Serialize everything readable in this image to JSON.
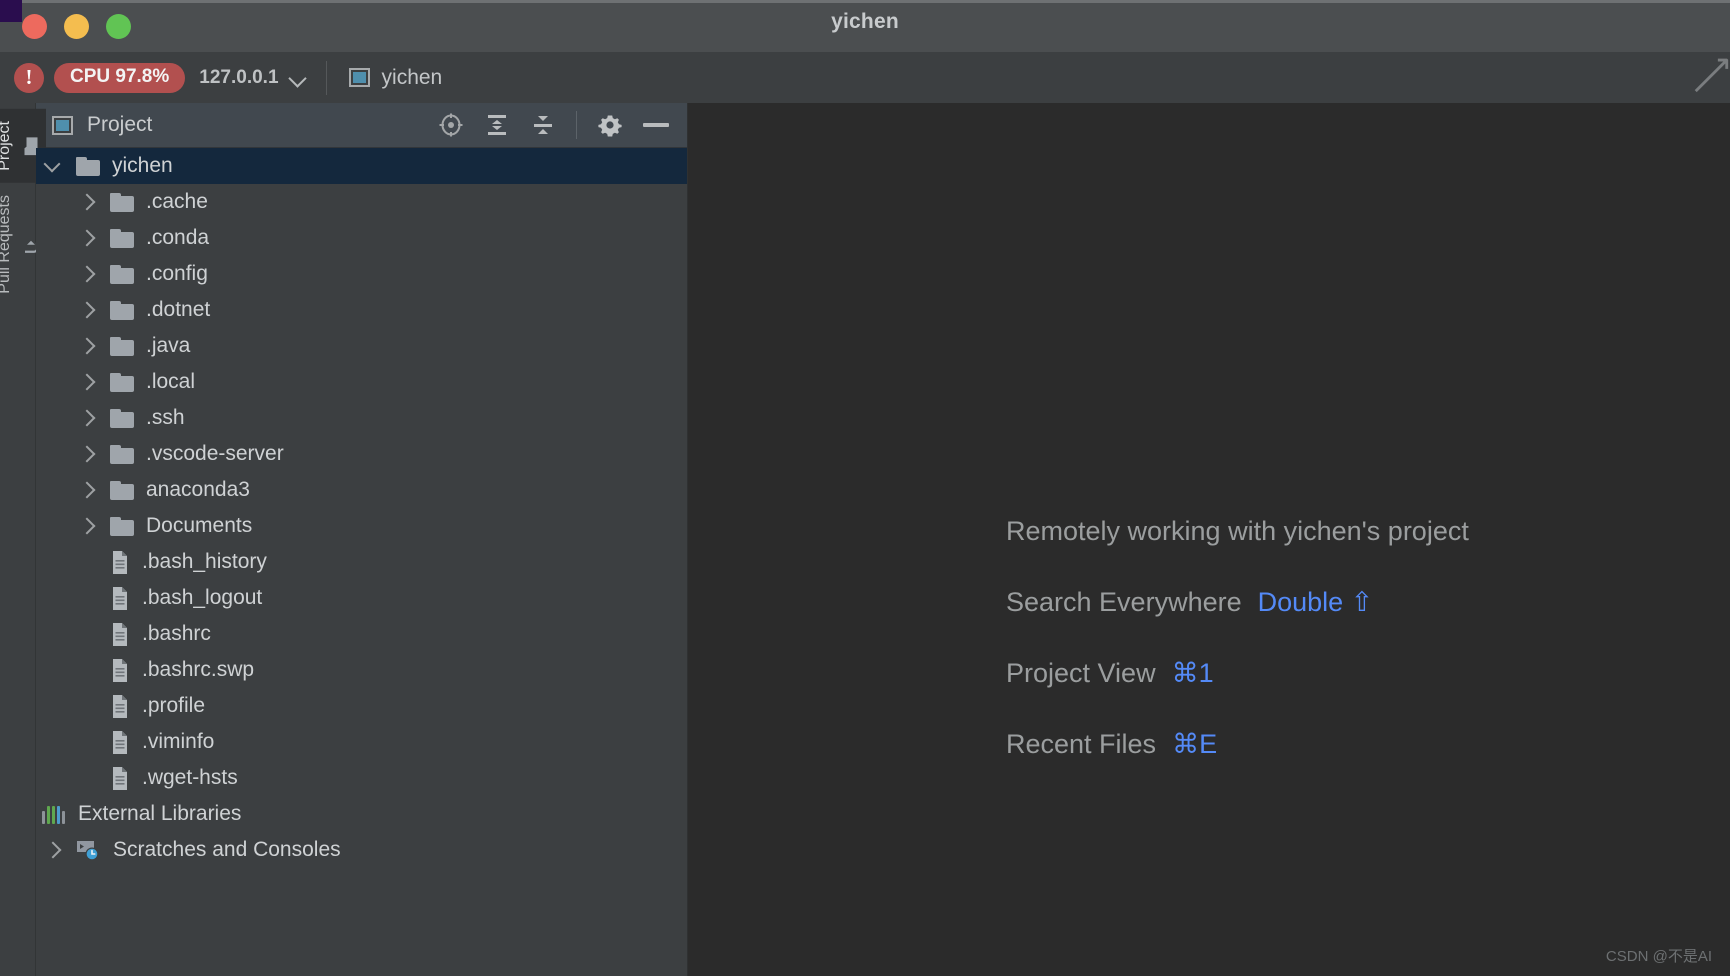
{
  "window": {
    "title": "yichen",
    "traffic_lights": [
      "close-button",
      "minimize-button",
      "maximize-button"
    ]
  },
  "toolbar": {
    "error_icon": "!",
    "cpu_badge": "CPU 97.8%",
    "host": "127.0.0.1",
    "host_dropdown_icon": "chevron-down-icon",
    "project_chip": "yichen",
    "edge_arrow_icon": "arrow-icon"
  },
  "rail": {
    "tabs": [
      {
        "label": "Project",
        "icon": "folder-icon",
        "active": true
      },
      {
        "label": "Pull Requests",
        "icon": "pull-request-icon",
        "active": false
      }
    ]
  },
  "panel": {
    "title": "Project",
    "title_icon": "project-window-icon",
    "tools": [
      {
        "name": "select-opened-file-icon",
        "label": "Select Opened File"
      },
      {
        "name": "expand-all-icon",
        "label": "Expand All"
      },
      {
        "name": "collapse-all-icon",
        "label": "Collapse All"
      },
      {
        "name": "gear-icon",
        "label": "Options"
      },
      {
        "name": "hide-icon",
        "label": "Hide"
      }
    ]
  },
  "tree": {
    "nodes": [
      {
        "label": "yichen",
        "type": "folder",
        "arrow": "down",
        "depth": 0,
        "selected": true
      },
      {
        "label": ".cache",
        "type": "folder",
        "arrow": "right",
        "depth": 1,
        "selected": false
      },
      {
        "label": ".conda",
        "type": "folder",
        "arrow": "right",
        "depth": 1,
        "selected": false
      },
      {
        "label": ".config",
        "type": "folder",
        "arrow": "right",
        "depth": 1,
        "selected": false
      },
      {
        "label": ".dotnet",
        "type": "folder",
        "arrow": "right",
        "depth": 1,
        "selected": false
      },
      {
        "label": ".java",
        "type": "folder",
        "arrow": "right",
        "depth": 1,
        "selected": false
      },
      {
        "label": ".local",
        "type": "folder",
        "arrow": "right",
        "depth": 1,
        "selected": false
      },
      {
        "label": ".ssh",
        "type": "folder",
        "arrow": "right",
        "depth": 1,
        "selected": false
      },
      {
        "label": ".vscode-server",
        "type": "folder",
        "arrow": "right",
        "depth": 1,
        "selected": false
      },
      {
        "label": "anaconda3",
        "type": "folder",
        "arrow": "right",
        "depth": 1,
        "selected": false
      },
      {
        "label": "Documents",
        "type": "folder",
        "arrow": "right",
        "depth": 1,
        "selected": false
      },
      {
        "label": ".bash_history",
        "type": "file",
        "arrow": "none",
        "depth": 1,
        "selected": false
      },
      {
        "label": ".bash_logout",
        "type": "file",
        "arrow": "none",
        "depth": 1,
        "selected": false
      },
      {
        "label": ".bashrc",
        "type": "file",
        "arrow": "none",
        "depth": 1,
        "selected": false
      },
      {
        "label": ".bashrc.swp",
        "type": "file",
        "arrow": "none",
        "depth": 1,
        "selected": false
      },
      {
        "label": ".profile",
        "type": "file",
        "arrow": "none",
        "depth": 1,
        "selected": false
      },
      {
        "label": ".viminfo",
        "type": "file",
        "arrow": "none",
        "depth": 1,
        "selected": false
      },
      {
        "label": ".wget-hsts",
        "type": "file",
        "arrow": "none",
        "depth": 1,
        "selected": false
      },
      {
        "label": "External Libraries",
        "type": "library",
        "arrow": "none",
        "depth": 0,
        "selected": false
      },
      {
        "label": "Scratches and Consoles",
        "type": "scratch",
        "arrow": "right",
        "depth": 0,
        "selected": false
      }
    ]
  },
  "editor": {
    "lines": [
      {
        "text": "Remotely working with yichen's project",
        "shortcut": ""
      },
      {
        "text": "Search Everywhere",
        "shortcut": "Double ⇧"
      },
      {
        "text": "Project View",
        "shortcut": "⌘1"
      },
      {
        "text": "Recent Files",
        "shortcut": "⌘E"
      }
    ],
    "watermark": "CSDN @不是AI"
  },
  "colors": {
    "accent_blue": "#548af7",
    "cpu_badge": "#b2504f",
    "selection": "#14283d",
    "editor_bg": "#2b2b2b",
    "panel_bg": "#3c3f41"
  }
}
